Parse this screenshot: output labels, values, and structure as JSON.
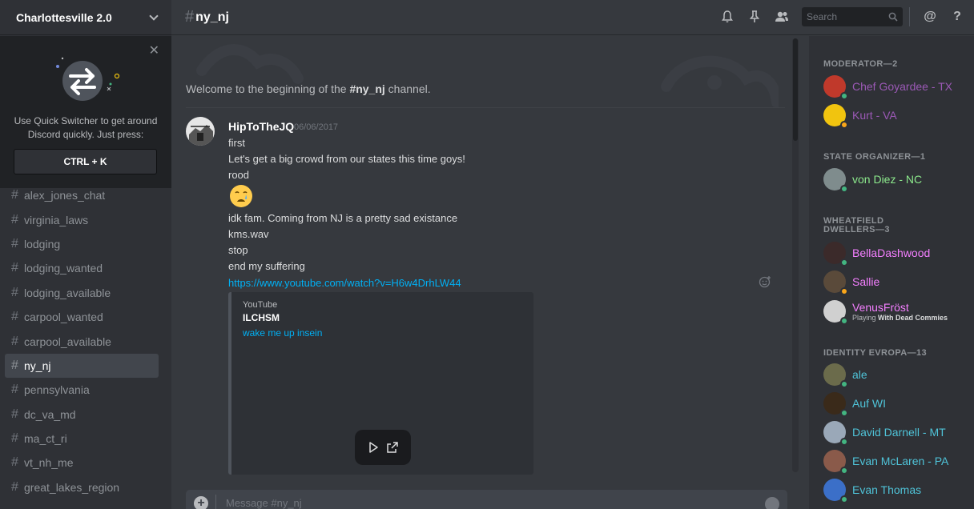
{
  "guild": {
    "name": "Charlottesville 2.0"
  },
  "quick_switcher": {
    "text": "Use Quick Switcher to get around Discord quickly. Just press:",
    "shortcut": "CTRL + K"
  },
  "channels": [
    {
      "name": "alex_jones_chat",
      "active": false
    },
    {
      "name": "virginia_laws",
      "active": false
    },
    {
      "name": "lodging",
      "active": false
    },
    {
      "name": "lodging_wanted",
      "active": false
    },
    {
      "name": "lodging_available",
      "active": false
    },
    {
      "name": "carpool_wanted",
      "active": false
    },
    {
      "name": "carpool_available",
      "active": false
    },
    {
      "name": "ny_nj",
      "active": true
    },
    {
      "name": "pennsylvania",
      "active": false
    },
    {
      "name": "dc_va_md",
      "active": false
    },
    {
      "name": "ma_ct_ri",
      "active": false
    },
    {
      "name": "vt_nh_me",
      "active": false
    },
    {
      "name": "great_lakes_region",
      "active": false
    }
  ],
  "header": {
    "channel": "ny_nj",
    "search_placeholder": "Search",
    "icons": [
      "bell-icon",
      "pin-icon",
      "members-icon",
      "search-icon",
      "mention-icon",
      "help-icon"
    ]
  },
  "welcome": {
    "prefix": "Welcome to the beginning of the ",
    "channel": "#ny_nj",
    "suffix": " channel."
  },
  "message": {
    "author": "HipToTheJQ",
    "timestamp": "06/06/2017",
    "lines": [
      "first",
      "Let's get a big crowd from our states this time goys!",
      "rood",
      "idk fam. Coming from NJ is a pretty sad existance",
      "kms.wav",
      "stop",
      "end my suffering"
    ],
    "emoji": "crying-face",
    "link": "https://www.youtube.com/watch?v=H6w4DrhLW44",
    "embed": {
      "provider": "YouTube",
      "title": "ILCHSM",
      "description": "wake me up insein"
    }
  },
  "composer": {
    "placeholder": "Message #ny_nj"
  },
  "member_groups": [
    {
      "title": "MODERATOR—2",
      "members": [
        {
          "name": "Chef Goyardee - TX",
          "color": "#9b59b6",
          "status": "#43b581",
          "avatar": "#c0392b",
          "activity": ""
        },
        {
          "name": "Kurt - VA",
          "color": "#9b59b6",
          "status": "#faa61a",
          "avatar": "#f1c40f",
          "activity": ""
        }
      ]
    },
    {
      "title": "STATE ORGANIZER—1",
      "members": [
        {
          "name": "von Diez - NC",
          "color": "#8ce98c",
          "status": "#43b581",
          "avatar": "#7f8c8d",
          "activity": ""
        }
      ]
    },
    {
      "title": "WHEATFIELD DWELLERS—3",
      "members": [
        {
          "name": "BellaDashwood",
          "color": "#f47fff",
          "status": "#43b581",
          "avatar": "#3b2a2a",
          "activity": ""
        },
        {
          "name": "Sallie",
          "color": "#f47fff",
          "status": "#faa61a",
          "avatar": "#5a4a3a",
          "activity": ""
        },
        {
          "name": "VenusFröst",
          "color": "#f47fff",
          "status": "#43b581",
          "avatar": "#d0d0d0",
          "activity_prefix": "Playing ",
          "activity": "With Dead Commies"
        }
      ]
    },
    {
      "title": "IDENTITY EVROPA—13",
      "members": [
        {
          "name": "ale",
          "color": "#4fc3d8",
          "status": "#43b581",
          "avatar": "#6b6b4b",
          "activity": ""
        },
        {
          "name": "Auf WI",
          "color": "#4fc3d8",
          "status": "#43b581",
          "avatar": "#3a2a1a",
          "activity": ""
        },
        {
          "name": "David Darnell - MT",
          "color": "#4fc3d8",
          "status": "#43b581",
          "avatar": "#9aa8b8",
          "activity": ""
        },
        {
          "name": "Evan McLaren - PA",
          "color": "#4fc3d8",
          "status": "#43b581",
          "avatar": "#8a5a4a",
          "activity": ""
        },
        {
          "name": "Evan Thomas",
          "color": "#4fc3d8",
          "status": "#43b581",
          "avatar": "#3b6fc8",
          "activity": ""
        }
      ]
    }
  ]
}
